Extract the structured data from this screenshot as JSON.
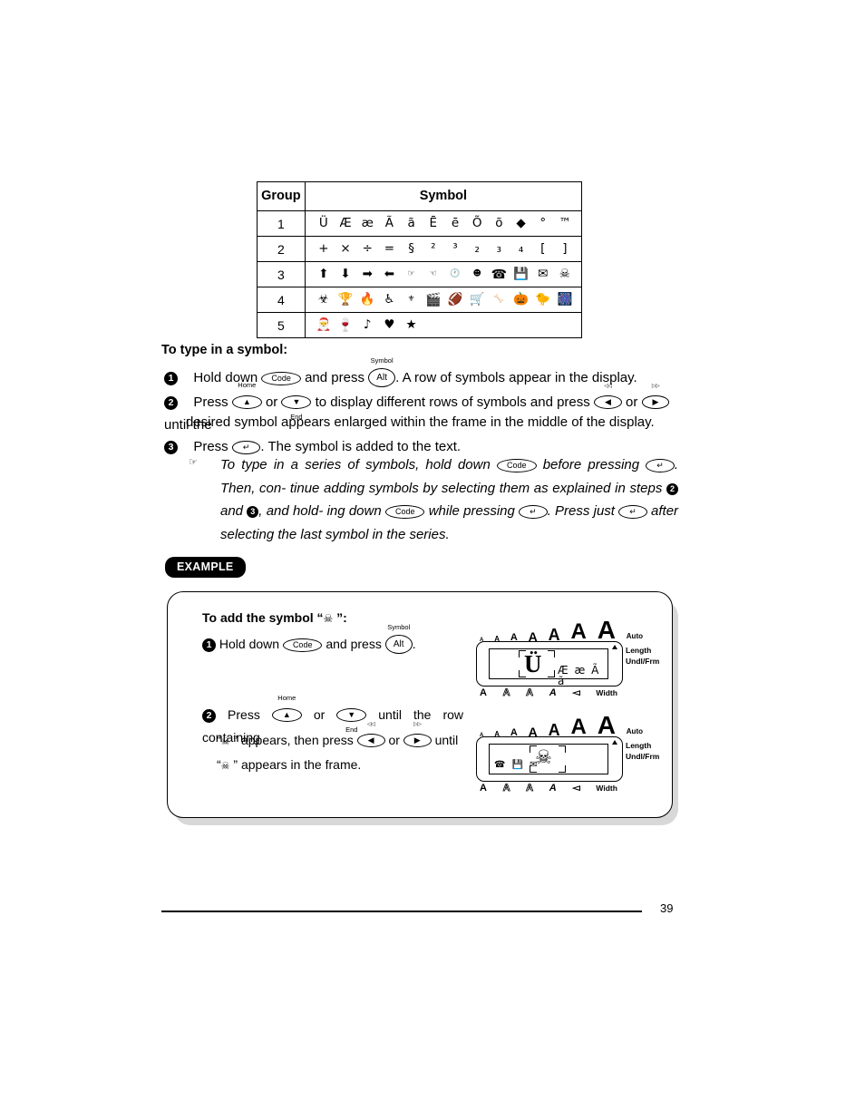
{
  "table": {
    "headers": [
      "Group",
      "Symbol"
    ],
    "rows": [
      {
        "group": "1",
        "symbols": [
          "Ü",
          "Æ",
          "æ",
          "Ã",
          "ã",
          "Ē",
          "ē",
          "Õ",
          "õ",
          "◆",
          "°",
          "™"
        ]
      },
      {
        "group": "2",
        "symbols": [
          "+",
          "×",
          "÷",
          "=",
          "§",
          "²",
          "³",
          "₂",
          "₃",
          "₄",
          "[",
          "]"
        ]
      },
      {
        "group": "3",
        "symbols": [
          "⬆",
          "⬇",
          "➡",
          "⬅",
          "☞",
          "☜",
          "🕐",
          "☻",
          "☎",
          "💾",
          "✉",
          "☠"
        ]
      },
      {
        "group": "4",
        "symbols": [
          "☣",
          "🏆",
          "🔥",
          "♿",
          "⚜",
          "🎬",
          "🏈",
          "🛒",
          "🦴",
          "🎃",
          "🐤",
          "🎆"
        ]
      },
      {
        "group": "5",
        "symbols": [
          "🎅",
          "🍷",
          "♪",
          "♥",
          "★"
        ]
      }
    ]
  },
  "procedure": {
    "heading": "To type in a symbol:",
    "step1": {
      "num": "1",
      "pre": "Hold down",
      "key_code": "Code",
      "mid": "and press",
      "key_alt": "Alt",
      "key_alt_label": "Symbol",
      "post": ". A row of symbols appear in the display."
    },
    "step2": {
      "num": "2",
      "pre": "Press",
      "key_up_label": "Home",
      "or1": "or",
      "key_down_label": "End",
      "mid": "to display different rows of symbols and press",
      "key_left_label": "◁◁",
      "or2": "or",
      "key_right_label": "▷▷",
      "post": "until the",
      "line2": "desired symbol appears enlarged within the frame in the middle of the display."
    },
    "step3": {
      "num": "3",
      "pre": "Press",
      "key_enter": "↵",
      "post": ". The symbol is added to the text."
    },
    "note": {
      "icon": "☞",
      "seg1": "To type in a series of symbols, hold down",
      "key_code": "Code",
      "seg2": "before pressing",
      "key_enter": "↵",
      "seg3": ". Then, con-",
      "seg4": "tinue adding symbols by selecting them as explained in steps",
      "num2": "2",
      "seg5": "and",
      "num3": "3",
      "seg6": ", and hold-",
      "seg7": "ing down",
      "seg8": "while pressing",
      "seg9": ". Press just",
      "seg10": "after selecting the last",
      "seg11": "symbol in the series."
    }
  },
  "example": {
    "badge": "EXAMPLE",
    "heading_pre": "To add the symbol “",
    "heading_symbol": "☠",
    "heading_post": " ”:",
    "step1": {
      "num": "1",
      "pre": "Hold down",
      "key_code": "Code",
      "mid": "and press",
      "key_alt": "Alt",
      "key_alt_label": "Symbol",
      "post": "."
    },
    "step2": {
      "num": "2",
      "pre": "Press",
      "key_up_label": "Home",
      "or1": "or",
      "key_down_label": "End",
      "mid": "until the row containing",
      "line2_pre": "“",
      "line2_sym": "☠",
      "line2_mid": " ” appears, then press",
      "key_left_label": "◁◁",
      "or2": "or",
      "key_right_label": "▷▷",
      "line2_post": "until",
      "line3_pre": "“",
      "line3_sym": "☠",
      "line3_post": " ” appears in the frame."
    },
    "lcd1": {
      "scale": [
        "A",
        "A",
        "A",
        "A",
        "A",
        "A",
        "A"
      ],
      "auto": "Auto",
      "right_labels": [
        "Length",
        "Undl/Frm"
      ],
      "framed_char": "Ü",
      "trailing_chars": "Æ æ Ã ã",
      "leading_chars": "",
      "bottom": [
        "A",
        "A",
        "A",
        "A",
        "◅"
      ],
      "width_label": "Width"
    },
    "lcd2": {
      "scale": [
        "A",
        "A",
        "A",
        "A",
        "A",
        "A",
        "A"
      ],
      "auto": "Auto",
      "right_labels": [
        "Length",
        "Undl/Frm"
      ],
      "framed_char": "☠",
      "trailing_chars": "",
      "leading_chars": "☎ 💾 ✉",
      "bottom": [
        "A",
        "A",
        "A",
        "A",
        "◅"
      ],
      "width_label": "Width"
    }
  },
  "footer": {
    "page_number": "39"
  }
}
